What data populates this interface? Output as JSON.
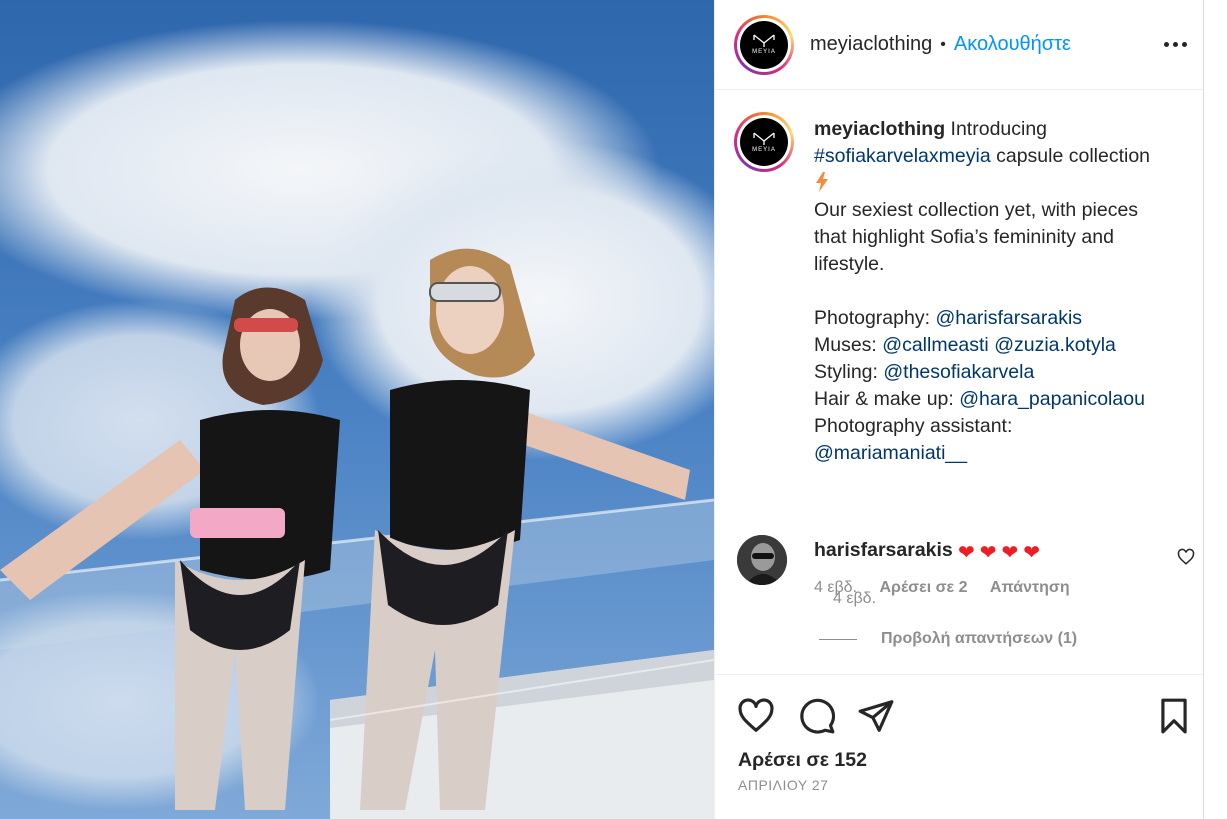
{
  "post": {
    "username": "meyiaclothing",
    "follow_label": "Ακολουθήστε",
    "brand_mark": "MEYIA",
    "caption_line1": "Introducing",
    "hashtag": "#sofiakarvelaxmeyia",
    "caption_line2": "capsule collection",
    "desc_line1": "Our sexiest collection yet, with pieces",
    "desc_line2": "that highlight Sofia’s femininity and",
    "desc_line3": "lifestyle.",
    "credits": {
      "photo_label": "Photography:",
      "photo_handle": "@harisfarsarakis",
      "muses_label": "Muses:",
      "muses_handle1": "@callmeasti",
      "muses_handle2": "@zuzia.kotyla",
      "styling_label": "Styling:",
      "styling_handle": "@thesofiakarvela",
      "hair_label": "Hair & make up:",
      "hair_handle": "@hara_papanicolaou",
      "assistant_label": "Photography assistant:",
      "assistant_handle": "@mariamaniati__"
    },
    "caption_time": "4 εβδ."
  },
  "comment": {
    "username": "harisfarsarakis",
    "hearts": "❤❤❤❤",
    "time": "4 εβδ.",
    "likes": "Αρέσει σε 2",
    "reply": "Απάντηση",
    "view_replies": "Προβολή απαντήσεων (1)"
  },
  "footer": {
    "likes": "Αρέσει σε 152",
    "date": "ΑΠΡΙΛΙΟΥ 27"
  },
  "icons": {
    "header_more": "more-horizontal-icon",
    "comment_like": "heart-outline-icon",
    "like": "heart-outline-icon",
    "comment": "comment-bubble-icon",
    "share": "paper-plane-icon",
    "save": "bookmark-icon",
    "caption_emoji": "lightning-bolt-icon"
  },
  "colors": {
    "link": "#00376b",
    "follow": "#0095f6",
    "heart": "#ed1d24",
    "secondary_text": "#8e8e8e"
  }
}
